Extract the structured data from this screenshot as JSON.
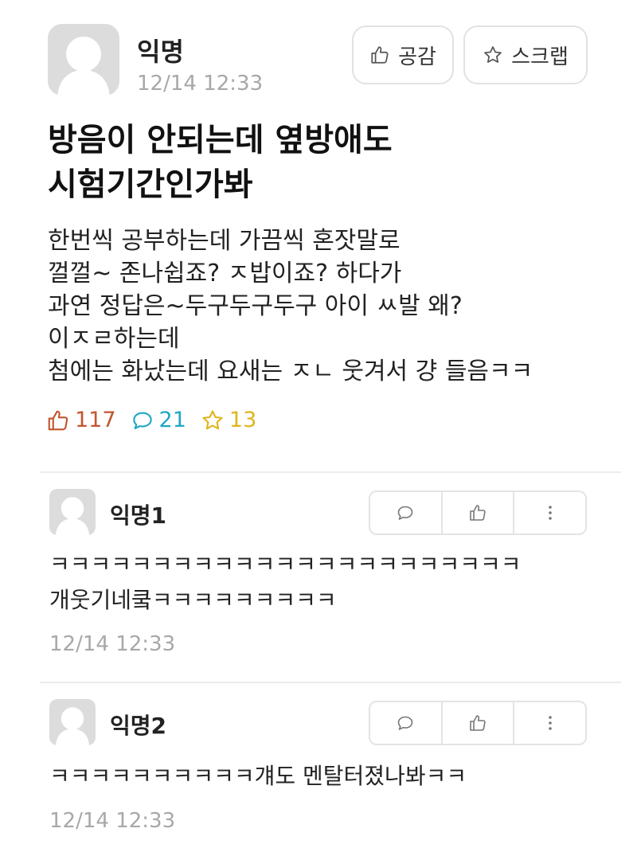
{
  "post": {
    "author": "익명",
    "time": "12/14 12:33",
    "like_button_label": "공감",
    "scrap_button_label": "스크랩",
    "title_lines": [
      "방음이 안되는데 옆방애도",
      "시험기간인가봐"
    ],
    "body_lines": [
      "한번씩 공부하는데 가끔씩 혼잣말로",
      "껄껄~ 존나쉽죠? ㅈ밥이죠? 하다가",
      "과연 정답은~두구두구두구 아이 ㅆ발 왜?",
      "이ㅈㄹ하는데",
      "첨에는 화났는데 요새는 ㅈㄴ 웃겨서 걍 들음ㅋㅋ"
    ],
    "stats": {
      "likes": "117",
      "comments": "21",
      "scraps": "13"
    }
  },
  "comments": [
    {
      "author": "익명1",
      "lines": [
        "ㅋㅋㅋㅋㅋㅋㅋㅋㅋㅋㅋㅋㅋㅋㅋㅋㅋㅋㅋㅋㅋㅋㅋ",
        "개웃기네쿸ㅋㅋㅋㅋㅋㅋㅋㅋㅋ"
      ],
      "time": "12/14 12:33"
    },
    {
      "author": "익명2",
      "lines": [
        "ㅋㅋㅋㅋㅋㅋㅋㅋㅋㅋ걔도 멘탈터졌나봐ㅋㅋ"
      ],
      "time": "12/14 12:33"
    }
  ],
  "colors": {
    "like": "#c1552f",
    "comment": "#1fa7c4",
    "scrap": "#e0b51c",
    "muted": "#a8a8a8"
  },
  "icons": [
    "avatar-placeholder-icon",
    "thumbs-up-icon",
    "star-icon",
    "speech-bubble-icon",
    "more-vertical-icon"
  ]
}
